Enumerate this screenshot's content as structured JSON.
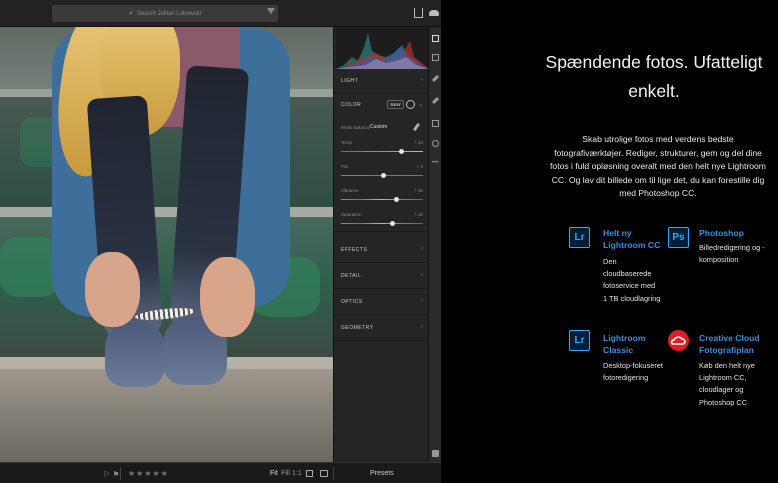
{
  "app": {
    "search_placeholder": "Search Jullian Lukowski",
    "edit_panel": {
      "sections": [
        {
          "label": "LIGHT"
        },
        {
          "label": "COLOR"
        },
        {
          "label": "EFFECTS"
        },
        {
          "label": "DETAIL"
        },
        {
          "label": "OPTICS"
        },
        {
          "label": "GEOMETRY"
        }
      ],
      "bw_label": "B&W",
      "white_balance_label": "White Balance",
      "white_balance_value": "Custom",
      "sliders": [
        {
          "label": "Temp",
          "value": "+ 23",
          "position": 0.74,
          "track": "temp"
        },
        {
          "label": "Tint",
          "value": "+ 5",
          "position": 0.52,
          "track": "tint"
        },
        {
          "label": "Vibrance",
          "value": "+ 36",
          "position": 0.68,
          "track": "vib"
        },
        {
          "label": "Saturation",
          "value": "+ 22",
          "position": 0.63,
          "track": "sat"
        }
      ]
    },
    "bottom_bar": {
      "flags": "⚐ ⚑",
      "rating": "★★★★★",
      "fit": "Fit",
      "fill": "Fill",
      "ratio": "1:1",
      "presets": "Presets"
    }
  },
  "promo": {
    "headline": "Spændende fotos. Ufatteligt enkelt.",
    "subtext": "Skab utrolige fotos med verdens bedste fotografiværktøjer. Rediger, strukturer, gem og del dine fotos i fuld opløsning overalt med den helt nye Lightroom CC. Og lav dit billede om til lige det, du kan forestille dig med Photoshop CC.",
    "products": [
      {
        "icon": "Lr",
        "title": "Helt ny Lightroom CC",
        "desc": "Den cloudbaserede fotoservice med 1 TB cloudlagring"
      },
      {
        "icon": "Ps",
        "title": "Photoshop",
        "desc": "Billedredigering og -komposition"
      },
      {
        "icon": "Lr",
        "title": "Lightroom Classic",
        "desc": "Desktop-fokuseret fotoredigering"
      },
      {
        "icon": "cc",
        "title": "Creative Cloud Fotografiplan",
        "desc": "Køb den helt nye Lightroom CC, cloudlager og Photoshop CC"
      }
    ]
  },
  "colors": {
    "accent_blue": "#3b8fe0",
    "lr_blue": "#31a8ff",
    "cc_red": "#da1f26"
  }
}
